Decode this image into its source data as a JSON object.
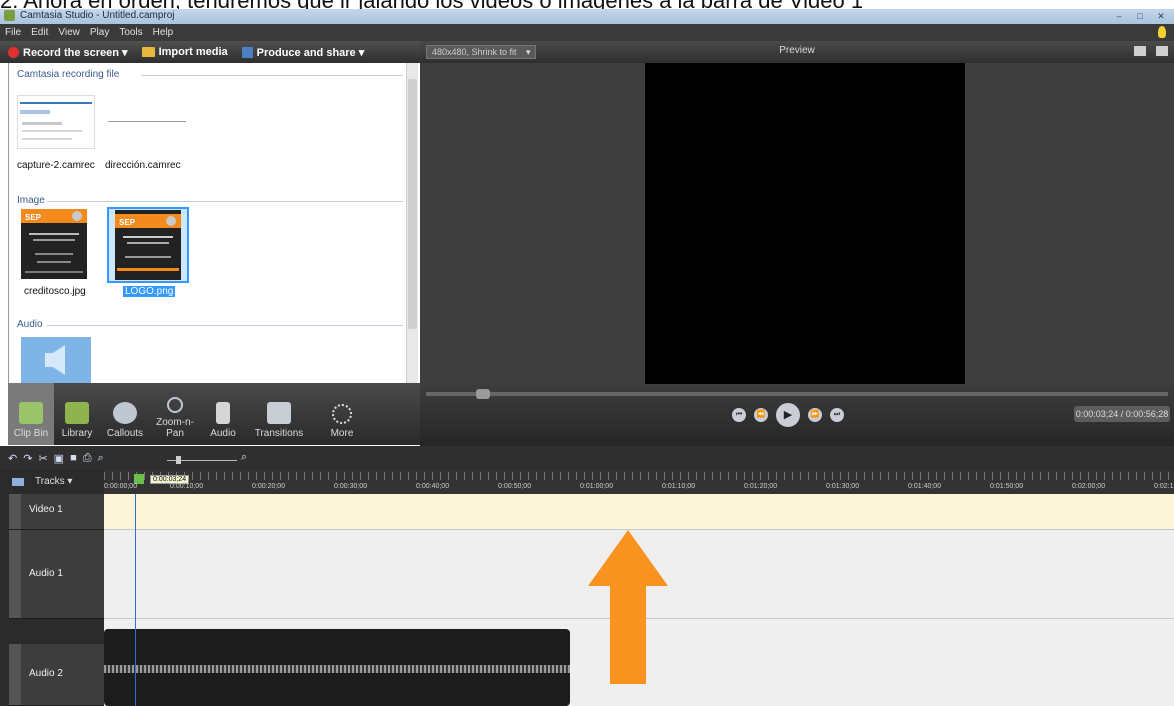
{
  "caption": "2. Ahora en orden, tendremos que ir jalando los videos o imágenes a la barra de Video 1",
  "window": {
    "title": "Camtasia Studio - Untitled.camproj",
    "controls": [
      "–",
      "□",
      "✕"
    ]
  },
  "menu": [
    "File",
    "Edit",
    "View",
    "Play",
    "Tools",
    "Help"
  ],
  "toolbar": {
    "record": "Record the screen ▾",
    "import": "Import media",
    "produce": "Produce and share ▾"
  },
  "clip_bin": {
    "sections": {
      "recording": "Camtasia recording file",
      "image": "Image",
      "audio": "Audio"
    },
    "recordings": [
      "capture-2.camrec",
      "dirección.camrec"
    ],
    "images": [
      "creditosco.jpg",
      "LOGO.png"
    ],
    "selected_image": "LOGO.png"
  },
  "task_tabs": [
    {
      "label": "Clip Bin",
      "icon": "clip-bin-icon",
      "active": true
    },
    {
      "label": "Library",
      "icon": "library-icon",
      "active": false
    },
    {
      "label": "Callouts",
      "icon": "callouts-icon",
      "active": false
    },
    {
      "label": "Zoom-n-Pan",
      "icon": "zoom-n-pan-icon",
      "active": false
    },
    {
      "label": "Audio",
      "icon": "audio-icon",
      "active": false
    },
    {
      "label": "Transitions",
      "icon": "transitions-icon",
      "active": false
    },
    {
      "label": "More",
      "icon": "more-icon",
      "active": false
    }
  ],
  "preview": {
    "zoom_select": "480x480, Shrink to fit",
    "title": "Preview",
    "timecode": "0:00:03;24 / 0:00:56;28"
  },
  "timeline": {
    "tracks_label": "Tracks",
    "playhead_time": "0:00:03;24",
    "ruler_labels": [
      "0:00:00;00",
      "0:00:10;00",
      "0:00:20;00",
      "0:00:30;00",
      "0:00:40;00",
      "0:00:50;00",
      "0:01:00;00",
      "0:01:10;00",
      "0:01:20;00",
      "0:01:30;00",
      "0:01:40;00",
      "0:01:50;00",
      "0:02:00;00",
      "0:02:1"
    ],
    "tracks": [
      "Video 1",
      "Audio 1",
      "Audio 2"
    ]
  },
  "colors": {
    "arrow": "#f7931e",
    "video_lane": "#fbf6d8",
    "selection": "#3399ff"
  }
}
